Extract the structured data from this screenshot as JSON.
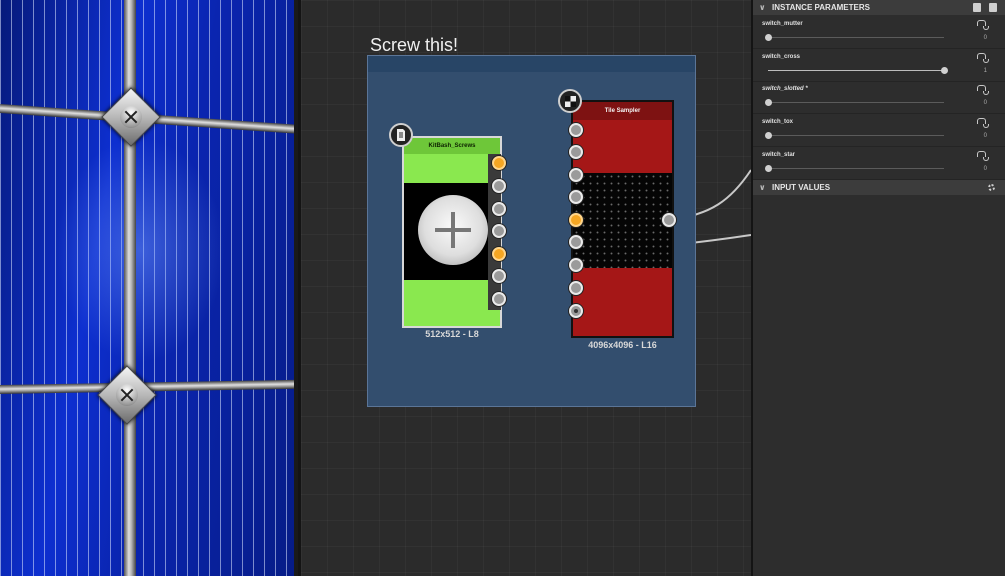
{
  "graph": {
    "frame_title": "Screw this!",
    "nodes": {
      "kitbash": {
        "title": "KitBash_Screws",
        "resolution": "512x512 - L8"
      },
      "tile_sampler": {
        "title": "Tile Sampler",
        "resolution": "4096x4096 - L16"
      }
    }
  },
  "panel": {
    "instance_parameters_header": "INSTANCE PARAMETERS",
    "input_values_header": "INPUT VALUES",
    "params": [
      {
        "name": "switch_mutter",
        "value": "0",
        "level": 0
      },
      {
        "name": "switch_cross",
        "value": "1",
        "level": 1
      },
      {
        "name": "switch_slotted *",
        "value": "0",
        "level": 0
      },
      {
        "name": "switch_tox",
        "value": "0",
        "level": 0
      },
      {
        "name": "switch_star",
        "value": "0",
        "level": 0
      }
    ]
  },
  "colors": {
    "frame": "#334e6e",
    "kitbash_accent": "#8ae84f",
    "tile_sampler_accent": "#a51717",
    "port_orange": "#f5a623"
  },
  "icons": {
    "kitbash_node": "document-icon",
    "tile_sampler_node": "checkerboard-icon",
    "panel_header": [
      "save-preset-icon",
      "load-preset-icon"
    ],
    "input_values": "gear-icon"
  }
}
